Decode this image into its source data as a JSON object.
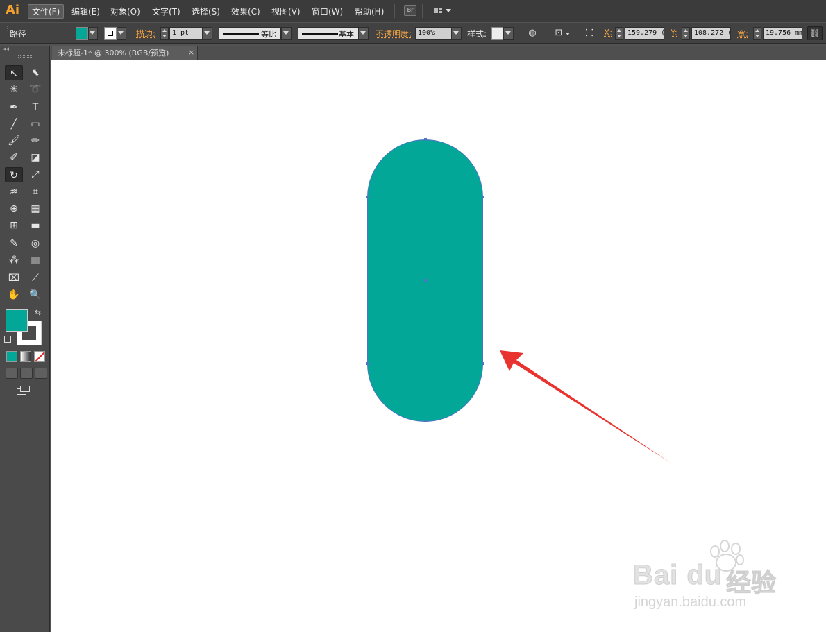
{
  "app": {
    "logo": "Ai"
  },
  "menu": {
    "items": [
      "文件(F)",
      "编辑(E)",
      "对象(O)",
      "文字(T)",
      "选择(S)",
      "效果(C)",
      "视图(V)",
      "窗口(W)",
      "帮助(H)"
    ],
    "active_index": 0,
    "bridge_label": "Br"
  },
  "controlbar": {
    "object_type": "路径",
    "fill_color": "#02a797",
    "stroke_label": "描边:",
    "stroke_weight": "1 pt",
    "profile_label": "等比",
    "brush_label": "基本",
    "opacity_label": "不透明度:",
    "opacity_value": "100%",
    "style_label": "样式:",
    "x_label": "X:",
    "x_value": "159.279 (",
    "y_label": "Y:",
    "y_value": "108.272 (",
    "w_label": "宽:",
    "w_value": "19.756 mm"
  },
  "document": {
    "tab_title": "未标题-1* @ 300% (RGB/预览)",
    "close_symbol": "×"
  },
  "tools": [
    {
      "name": "selection-tool-icon",
      "glyph": "↖"
    },
    {
      "name": "direct-selection-tool-icon",
      "glyph": "⬉"
    },
    {
      "name": "magic-wand-tool-icon",
      "glyph": "✳"
    },
    {
      "name": "lasso-tool-icon",
      "glyph": "➰"
    },
    {
      "name": "pen-tool-icon",
      "glyph": "✒"
    },
    {
      "name": "type-tool-icon",
      "glyph": "T"
    },
    {
      "name": "line-tool-icon",
      "glyph": "╱"
    },
    {
      "name": "rectangle-tool-icon",
      "glyph": "▭"
    },
    {
      "name": "paintbrush-tool-icon",
      "glyph": "🖌"
    },
    {
      "name": "pencil-tool-icon",
      "glyph": "✏"
    },
    {
      "name": "blob-brush-tool-icon",
      "glyph": "✐"
    },
    {
      "name": "eraser-tool-icon",
      "glyph": "◪"
    },
    {
      "name": "rotate-tool-icon",
      "glyph": "↻"
    },
    {
      "name": "scale-tool-icon",
      "glyph": "⤢"
    },
    {
      "name": "warp-tool-icon",
      "glyph": "♒"
    },
    {
      "name": "free-transform-tool-icon",
      "glyph": "⌗"
    },
    {
      "name": "shape-builder-tool-icon",
      "glyph": "⊕"
    },
    {
      "name": "perspective-grid-tool-icon",
      "glyph": "▦"
    },
    {
      "name": "mesh-tool-icon",
      "glyph": "⊞"
    },
    {
      "name": "gradient-tool-icon",
      "glyph": "▬"
    },
    {
      "name": "eyedropper-tool-icon",
      "glyph": "✎"
    },
    {
      "name": "blend-tool-icon",
      "glyph": "◎"
    },
    {
      "name": "symbol-sprayer-tool-icon",
      "glyph": "⁂"
    },
    {
      "name": "column-graph-tool-icon",
      "glyph": "▥"
    },
    {
      "name": "artboard-tool-icon",
      "glyph": "⌧"
    },
    {
      "name": "slice-tool-icon",
      "glyph": "⟋"
    },
    {
      "name": "hand-tool-icon",
      "glyph": "✋"
    },
    {
      "name": "zoom-tool-icon",
      "glyph": "🔍"
    }
  ],
  "watermark": {
    "brand": "Bai du",
    "brand_cn": "经验",
    "url": "jingyan.baidu.com"
  }
}
